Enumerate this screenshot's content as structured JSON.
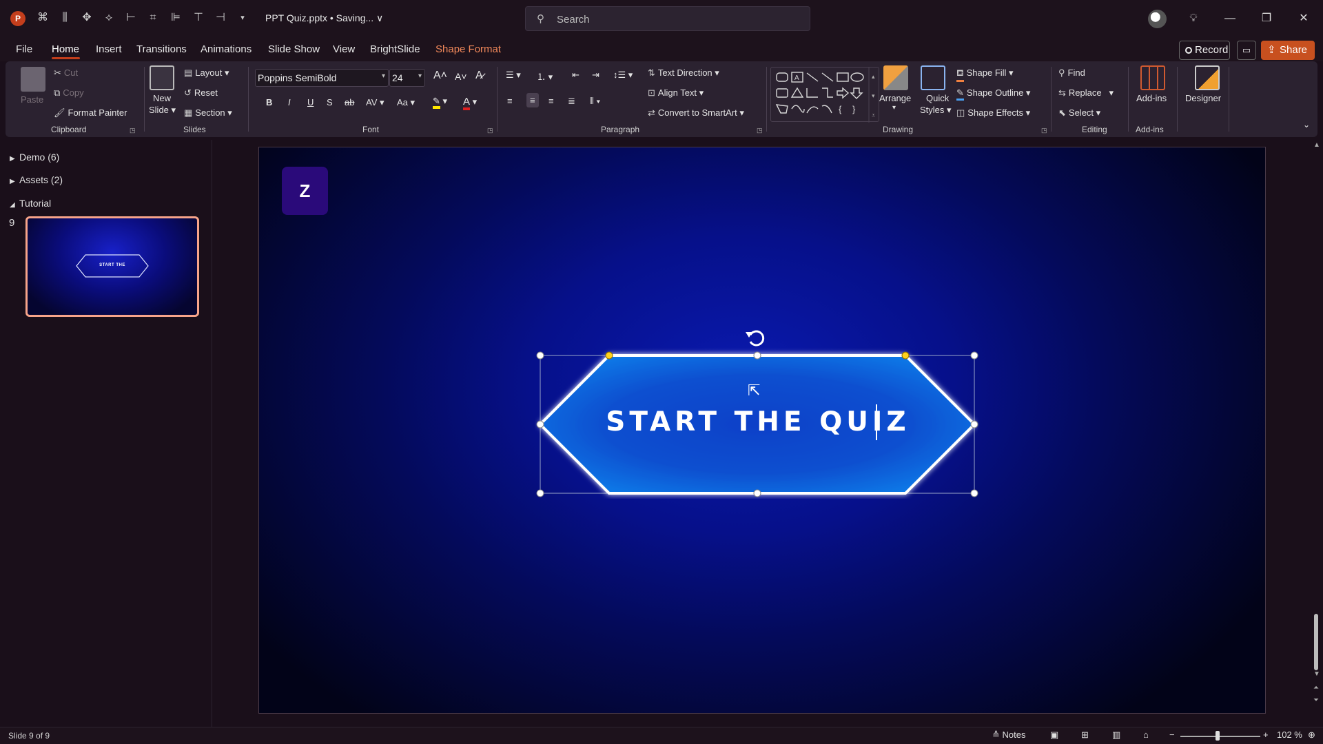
{
  "app": {
    "logo_letter": "P",
    "doc_title": "PPT Quiz.pptx • Saving... ∨",
    "search_placeholder": "Search",
    "qat_icons": [
      "autosave-icon",
      "align-icon",
      "distribute-icon",
      "shape-icon",
      "format-icon",
      "crop-icon",
      "align-left-icon",
      "align-top-icon",
      "align-right-icon",
      "customize-qat-icon"
    ]
  },
  "menu": {
    "tabs": [
      "File",
      "Home",
      "Insert",
      "Transitions",
      "Animations",
      "Slide Show",
      "View",
      "BrightSlide",
      "Shape Format"
    ],
    "active_tab": "Home",
    "record_label": "Record",
    "share_label": "Share"
  },
  "ribbon": {
    "clipboard": {
      "paste": "Paste",
      "cut": "Cut",
      "copy": "Copy",
      "format_painter": "Format Painter",
      "label": "Clipboard"
    },
    "slides": {
      "new_slide_line1": "New",
      "new_slide_line2": "Slide",
      "layout": "Layout",
      "reset": "Reset",
      "section": "Section",
      "label": "Slides"
    },
    "font": {
      "family": "Poppins SemiBold",
      "size": "24",
      "bold": "B",
      "italic": "I",
      "underline": "U",
      "shadow": "S",
      "strike": "ab",
      "spacing": "AV",
      "case": "Aa",
      "grow": "A˄",
      "shrink": "A˅",
      "color_a": "A",
      "label": "Font"
    },
    "paragraph": {
      "text_direction": "Text Direction",
      "align_text": "Align Text",
      "convert_smartart": "Convert to SmartArt",
      "label": "Paragraph"
    },
    "drawing": {
      "arrange": "Arrange",
      "quick_styles_line1": "Quick",
      "quick_styles_line2": "Styles",
      "shape_fill": "Shape Fill",
      "shape_outline": "Shape Outline",
      "shape_effects": "Shape Effects",
      "label": "Drawing"
    },
    "editing": {
      "find": "Find",
      "replace": "Replace",
      "select": "Select",
      "label": "Editing"
    },
    "addins": {
      "addins": "Add-ins",
      "label": "Add-ins"
    },
    "designer": {
      "label": "Designer"
    }
  },
  "left_panel": {
    "sections": [
      {
        "name": "Demo (6)",
        "expanded": false
      },
      {
        "name": "Assets (2)",
        "expanded": false
      },
      {
        "name": "Tutorial",
        "expanded": true
      }
    ],
    "slide_number": "9",
    "thumb_text": "START THE"
  },
  "slide": {
    "logo_letter": "Z",
    "button_text": "START THE QUIZ"
  },
  "status": {
    "slide_info": "Slide 9 of 9",
    "notes_label": "Notes",
    "zoom": "102 %"
  },
  "colors": {
    "accent": "#c43e1c",
    "share": "#c8501f",
    "shape_tab": "#f0885a",
    "thumb_border": "#f7a48a"
  }
}
